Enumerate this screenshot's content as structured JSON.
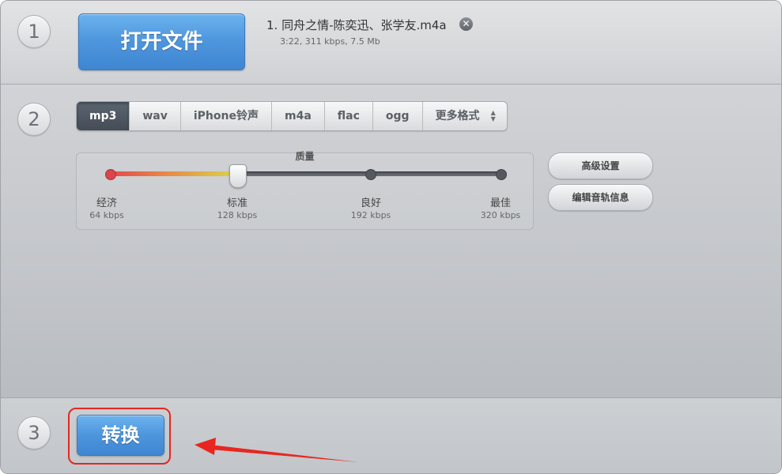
{
  "colors": {
    "accent_blue": "#4d95dc",
    "active_tab": "#4f5862",
    "annotation_red": "#e8261f",
    "slider_low": "#e5484d",
    "slider_mid": "#d9d64a"
  },
  "step1": {
    "number": "1",
    "open_button_label": "打开文件",
    "file": {
      "name": "1. 同舟之情-陈奕迅、张学友.m4a",
      "meta": "3:22, 311 kbps, 7.5 Mb",
      "remove_icon": "close-circle-icon"
    }
  },
  "step2": {
    "number": "2",
    "formats": [
      {
        "label": "mp3",
        "active": true
      },
      {
        "label": "wav",
        "active": false
      },
      {
        "label": "iPhone铃声",
        "active": false
      },
      {
        "label": "m4a",
        "active": false
      },
      {
        "label": "flac",
        "active": false
      },
      {
        "label": "ogg",
        "active": false
      },
      {
        "label": "更多格式",
        "active": false
      }
    ],
    "more_formats_icon": "up-down-arrows-icon",
    "quality": {
      "title": "质量",
      "selected_index": 1,
      "levels": [
        {
          "label": "经济",
          "kbps": "64 kbps"
        },
        {
          "label": "标准",
          "kbps": "128 kbps"
        },
        {
          "label": "良好",
          "kbps": "192 kbps"
        },
        {
          "label": "最佳",
          "kbps": "320 kbps"
        }
      ]
    },
    "advanced_settings_label": "高级设置",
    "edit_track_info_label": "编辑音轨信息"
  },
  "step3": {
    "number": "3",
    "convert_button_label": "转换"
  }
}
